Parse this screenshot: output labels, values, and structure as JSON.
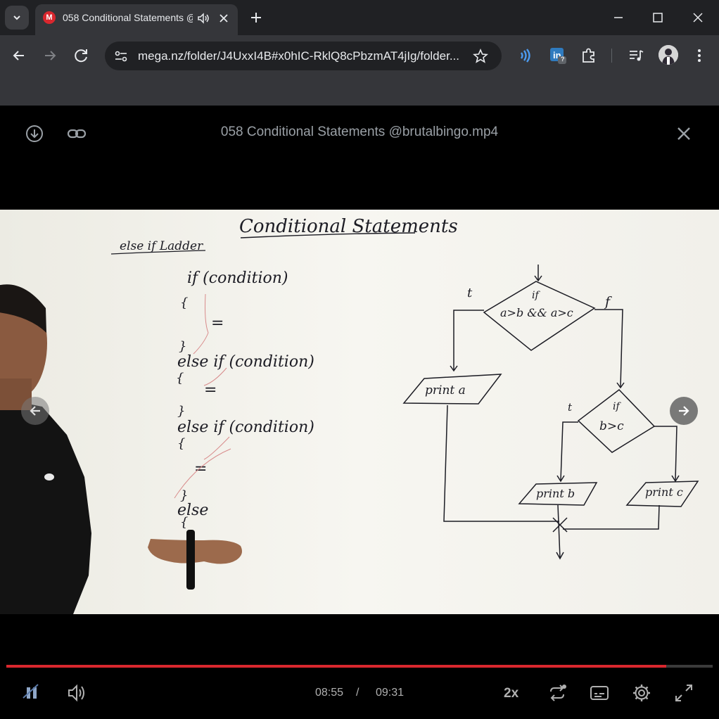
{
  "browser": {
    "tab": {
      "title": "058 Conditional Statements @brutalbingo.mp4",
      "favicon_letter": "M"
    },
    "url": "mega.nz/folder/J4UxxI4B#x0hIC-RklQ8cPbzmAT4jIg/folder...",
    "extension_badge": "?",
    "colors": {
      "tabstrip": "#202124",
      "toolbar": "#35363a",
      "mega_red": "#d9272e"
    }
  },
  "player": {
    "title": "058 Conditional Statements @brutalbingo.mp4",
    "current_time": "08:55",
    "time_separator": "/",
    "duration": "09:31",
    "progress_fraction": 0.9343,
    "speed": "2x"
  },
  "video_frame": {
    "heading": "Conditional Statements",
    "subheading": "else if Ladder",
    "code": [
      {
        "text": "if (condition)",
        "style": "big"
      },
      {
        "text": "{",
        "style": "brace"
      },
      {
        "text": "=",
        "style": "big"
      },
      {
        "text": "}",
        "style": "brace"
      },
      {
        "text": "else if (condition)",
        "style": "big"
      },
      {
        "text": "{",
        "style": "brace"
      },
      {
        "text": "=",
        "style": "big"
      },
      {
        "text": "}",
        "style": "brace"
      },
      {
        "text": "else if (condition)",
        "style": "big"
      },
      {
        "text": "{",
        "style": "brace"
      },
      {
        "text": "=",
        "style": "big"
      },
      {
        "text": "}",
        "style": "brace"
      },
      {
        "text": "else",
        "style": "big"
      },
      {
        "text": "{",
        "style": "brace"
      }
    ],
    "flowchart": {
      "cond1_if": "if",
      "cond1_expr": "a>b && a>c",
      "true_label": "t",
      "false_label": "f",
      "print_a": "print a",
      "cond2_if": "if",
      "cond2_expr": "b>c",
      "true_label_2": "t",
      "print_b": "print b",
      "print_c": "print c"
    }
  }
}
